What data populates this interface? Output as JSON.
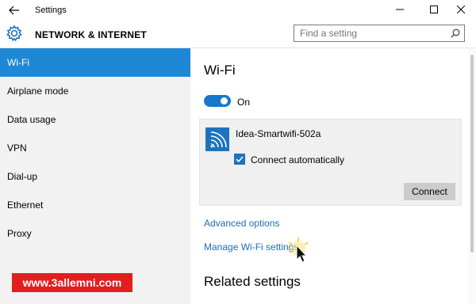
{
  "window": {
    "title": "Settings",
    "controls": {
      "minimize_icon": "minimize-icon",
      "maximize_icon": "maximize-icon",
      "close_icon": "close-icon"
    },
    "back_icon": "back-arrow-icon"
  },
  "header": {
    "section_title": "NETWORK & INTERNET",
    "icon": "gear-icon",
    "search": {
      "placeholder": "Find a setting",
      "value": "",
      "icon": "search-icon"
    }
  },
  "sidebar": {
    "items": [
      {
        "label": "Wi-Fi",
        "selected": true
      },
      {
        "label": "Airplane mode",
        "selected": false
      },
      {
        "label": "Data usage",
        "selected": false
      },
      {
        "label": "VPN",
        "selected": false
      },
      {
        "label": "Dial-up",
        "selected": false
      },
      {
        "label": "Ethernet",
        "selected": false
      },
      {
        "label": "Proxy",
        "selected": false
      }
    ]
  },
  "main": {
    "title": "Wi-Fi",
    "toggle": {
      "label": "On",
      "state": true
    },
    "network": {
      "name": "Idea-Smartwifi-502a",
      "icon": "wifi-signal-icon",
      "auto_connect_label": "Connect automatically",
      "auto_connect_checked": true,
      "connect_label": "Connect"
    },
    "links": {
      "advanced": "Advanced options",
      "manage": "Manage Wi-Fi settings"
    },
    "related_title": "Related settings"
  },
  "watermark": "www.3allemni.com",
  "colors": {
    "accent": "#1e88d6",
    "toggle_on": "#1677cc",
    "link": "#1a6eb5",
    "sidebar_bg": "#f2f2f2",
    "watermark_bg": "#e31e1e"
  }
}
